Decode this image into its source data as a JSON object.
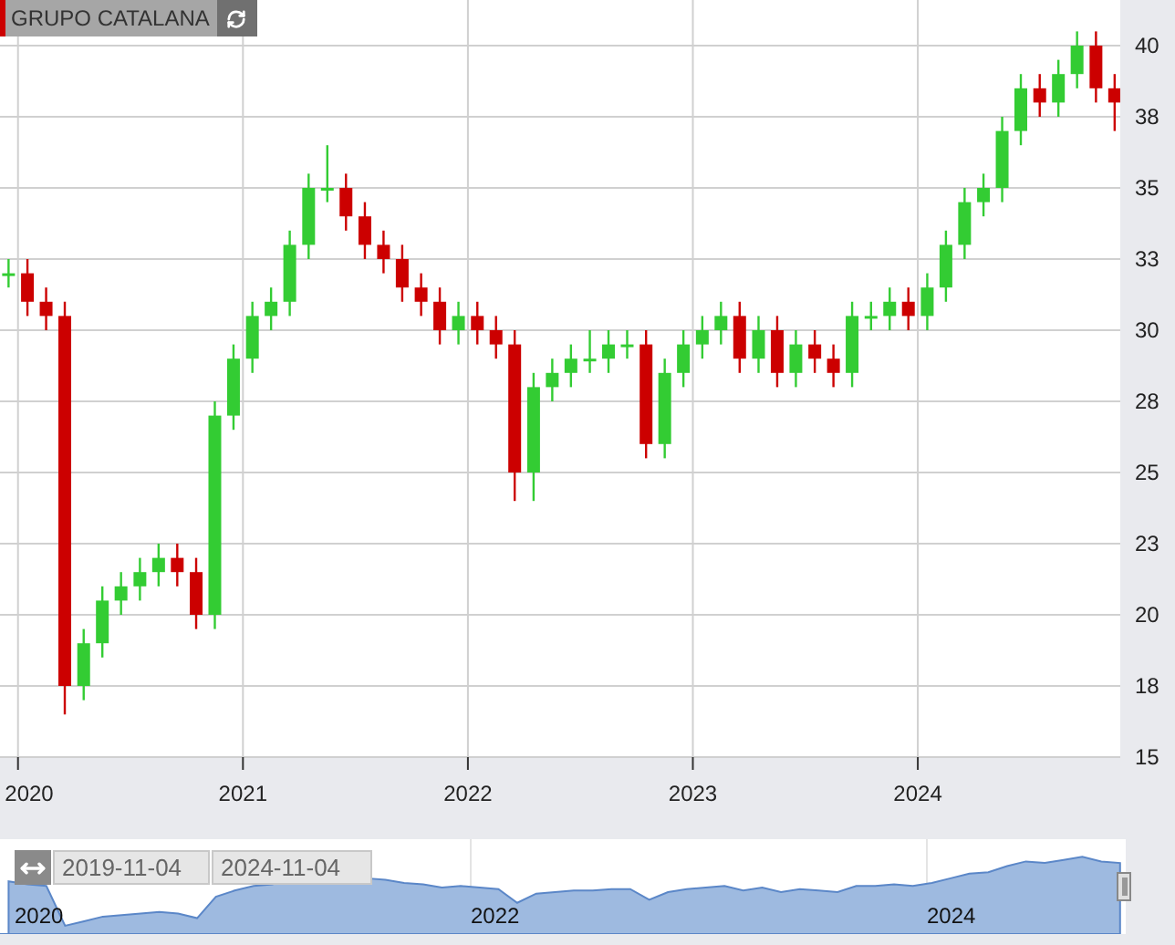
{
  "symbol_label": "GRUPO CATALANA",
  "chart": {
    "chart_data": {
      "type": "candlestick",
      "x": [
        2019.958,
        2020.042,
        2020.125,
        2020.208,
        2020.292,
        2020.375,
        2020.458,
        2020.542,
        2020.625,
        2020.708,
        2020.792,
        2020.875,
        2020.958,
        2021.042,
        2021.125,
        2021.208,
        2021.292,
        2021.375,
        2021.458,
        2021.542,
        2021.625,
        2021.708,
        2021.792,
        2021.875,
        2021.958,
        2022.042,
        2022.125,
        2022.208,
        2022.292,
        2022.375,
        2022.458,
        2022.542,
        2022.625,
        2022.708,
        2022.792,
        2022.875,
        2022.958,
        2023.042,
        2023.125,
        2023.208,
        2023.292,
        2023.375,
        2023.458,
        2023.542,
        2023.625,
        2023.708,
        2023.792,
        2023.875,
        2023.958,
        2024.042,
        2024.125,
        2024.208,
        2024.292,
        2024.375,
        2024.458,
        2024.542,
        2024.625,
        2024.708,
        2024.792,
        2024.875
      ],
      "ohlc": [
        [
          32,
          32.5,
          31.5,
          32
        ],
        [
          32,
          32.5,
          30.5,
          31
        ],
        [
          31,
          31.5,
          30,
          30.5
        ],
        [
          30.5,
          31,
          16.5,
          17.5
        ],
        [
          17.5,
          19.5,
          17,
          19
        ],
        [
          19,
          21,
          18.5,
          20.5
        ],
        [
          20.5,
          21.5,
          20,
          21
        ],
        [
          21,
          22,
          20.5,
          21.5
        ],
        [
          21.5,
          22.5,
          21,
          22
        ],
        [
          22,
          22.5,
          21,
          21.5
        ],
        [
          21.5,
          22,
          19.5,
          20
        ],
        [
          20,
          27.5,
          19.5,
          27
        ],
        [
          27,
          29.5,
          26.5,
          29
        ],
        [
          29,
          31,
          28.5,
          30.5
        ],
        [
          30.5,
          31.5,
          30,
          31
        ],
        [
          31,
          33.5,
          30.5,
          33
        ],
        [
          33,
          35.5,
          32.5,
          35
        ],
        [
          35,
          36.5,
          34.5,
          35
        ],
        [
          35,
          35.5,
          33.5,
          34
        ],
        [
          34,
          34.5,
          32.5,
          33
        ],
        [
          33,
          33.5,
          32,
          32.5
        ],
        [
          32.5,
          33,
          31,
          31.5
        ],
        [
          31.5,
          32,
          30.5,
          31
        ],
        [
          31,
          31.5,
          29.5,
          30
        ],
        [
          30,
          31,
          29.5,
          30.5
        ],
        [
          30.5,
          31,
          29.5,
          30
        ],
        [
          30,
          30.5,
          29,
          29.5
        ],
        [
          29.5,
          30,
          24,
          25
        ],
        [
          25,
          28.5,
          24,
          28
        ],
        [
          28,
          29,
          27.5,
          28.5
        ],
        [
          28.5,
          29.5,
          28,
          29
        ],
        [
          29,
          30,
          28.5,
          29
        ],
        [
          29,
          30,
          28.5,
          29.5
        ],
        [
          29.5,
          30,
          29,
          29.5
        ],
        [
          29.5,
          30,
          25.5,
          26
        ],
        [
          26,
          29,
          25.5,
          28.5
        ],
        [
          28.5,
          30,
          28,
          29.5
        ],
        [
          29.5,
          30.5,
          29,
          30
        ],
        [
          30,
          31,
          29.5,
          30.5
        ],
        [
          30.5,
          31,
          28.5,
          29
        ],
        [
          29,
          30.5,
          28.5,
          30
        ],
        [
          30,
          30.5,
          28,
          28.5
        ],
        [
          28.5,
          30,
          28,
          29.5
        ],
        [
          29.5,
          30,
          28.5,
          29
        ],
        [
          29,
          29.5,
          28,
          28.5
        ],
        [
          28.5,
          31,
          28,
          30.5
        ],
        [
          30.5,
          31,
          30,
          30.5
        ],
        [
          30.5,
          31.5,
          30,
          31
        ],
        [
          31,
          31.5,
          30,
          30.5
        ],
        [
          30.5,
          32,
          30,
          31.5
        ],
        [
          31.5,
          33.5,
          31,
          33
        ],
        [
          33,
          35,
          32.5,
          34.5
        ],
        [
          34.5,
          35.5,
          34,
          35
        ],
        [
          35,
          37.5,
          34.5,
          37
        ],
        [
          37,
          39,
          36.5,
          38.5
        ],
        [
          38.5,
          39,
          37.5,
          38
        ],
        [
          38,
          39.5,
          37.5,
          39
        ],
        [
          39,
          40.5,
          38.5,
          40
        ],
        [
          40,
          40.5,
          38,
          38.5
        ],
        [
          38.5,
          39,
          37,
          38
        ]
      ],
      "xlim": [
        2019.92,
        2024.9
      ],
      "ylim": [
        15,
        40
      ],
      "grid": true,
      "xticks": [
        2020,
        2021,
        2022,
        2023,
        2024
      ],
      "yticks": [
        {
          "value": 15,
          "label": "15"
        },
        {
          "value": 17.5,
          "label": "18"
        },
        {
          "value": 20,
          "label": "20"
        },
        {
          "value": 22.5,
          "label": "23"
        },
        {
          "value": 25,
          "label": "25"
        },
        {
          "value": 27.5,
          "label": "28"
        },
        {
          "value": 30,
          "label": "30"
        },
        {
          "value": 32.5,
          "label": "33"
        },
        {
          "value": 35,
          "label": "35"
        },
        {
          "value": 37.5,
          "label": "38"
        },
        {
          "value": 40,
          "label": "40"
        }
      ]
    }
  },
  "navigator": {
    "range_start": "2019-11-04",
    "range_end": "2024-11-04",
    "year_labels": [
      "2020",
      "2022",
      "2024"
    ]
  }
}
